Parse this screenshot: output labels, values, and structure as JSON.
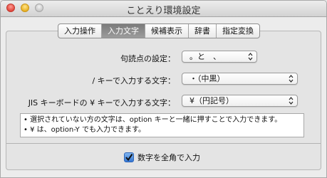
{
  "window": {
    "title": "ことえり環境設定"
  },
  "tabs": [
    {
      "label": "入力操作",
      "active": false
    },
    {
      "label": "入力文字",
      "active": true
    },
    {
      "label": "候補表示",
      "active": false
    },
    {
      "label": "辞書",
      "active": false
    },
    {
      "label": "指定変換",
      "active": false
    }
  ],
  "settings": {
    "punctuation": {
      "label": "句読点の設定：",
      "value": "。と　、"
    },
    "slash_key": {
      "label": "/ キーで入力する文字：",
      "value": "・（中黒）"
    },
    "yen_key": {
      "label": "JIS キーボードの ¥ キーで入力する文字：",
      "value": "¥（円記号）"
    }
  },
  "note": {
    "lines": [
      "• 選択されていない方の文字は、option キーと一緒に押すことで入力できます。",
      "• ¥ は、option-Y でも入力できます。"
    ]
  },
  "fullwidth_digits": {
    "label": "数字を全角で入力",
    "checked": true
  },
  "colors": {
    "accent": "#3476d2",
    "active_tab": "#8a8a8a"
  }
}
